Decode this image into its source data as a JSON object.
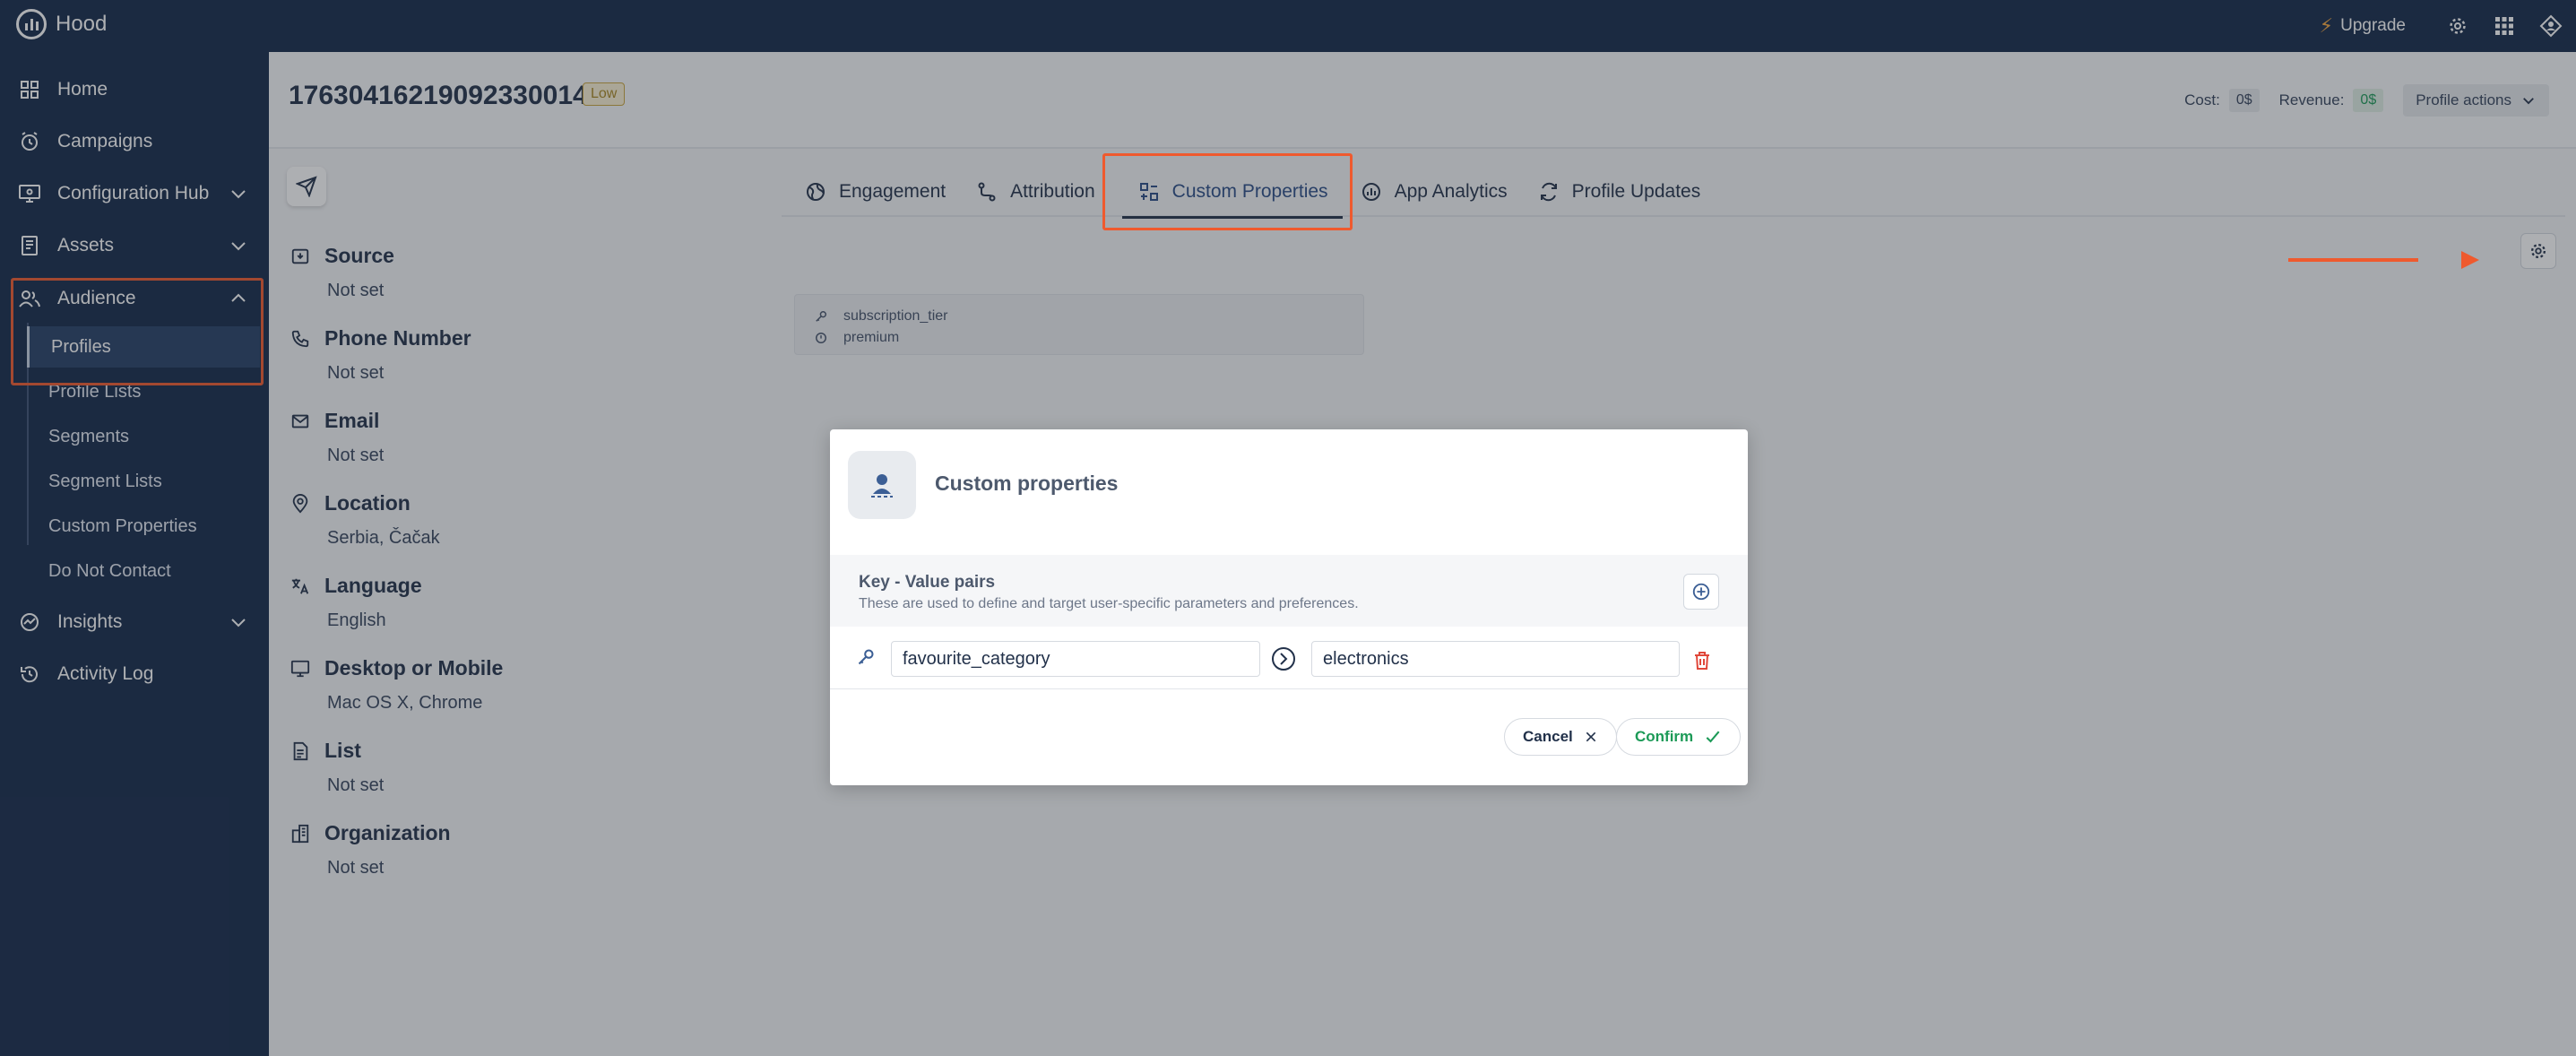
{
  "app": {
    "name": "Hood",
    "upgrade": "Upgrade"
  },
  "colors": {
    "nav_bg": "#14294a",
    "highlight": "#ef5a2e",
    "accent_green": "#1c9a57",
    "badge": "#caa53f"
  },
  "icons": {
    "settings": "gear-icon",
    "apps": "grid-icon",
    "avatar": "diamond-avatar-icon"
  },
  "sidebar": {
    "items": [
      {
        "label": "Home",
        "icon": "home-grid-icon"
      },
      {
        "label": "Campaigns",
        "icon": "clock-icon"
      },
      {
        "label": "Configuration Hub",
        "icon": "monitor-icon"
      },
      {
        "label": "Assets",
        "icon": "document-icon"
      },
      {
        "label": "Audience",
        "icon": "users-icon"
      },
      {
        "label": "Insights",
        "icon": "chart-icon"
      },
      {
        "label": "Activity Log",
        "icon": "history-icon"
      }
    ],
    "audience_sub": [
      "Profiles",
      "Profile Lists",
      "Segments",
      "Segment Lists",
      "Custom Properties",
      "Do Not Contact"
    ],
    "active_sub": "Profiles"
  },
  "profile": {
    "id": "17630416219092330014",
    "badge": "Low",
    "cost_label": "Cost:",
    "cost_value": "0$",
    "revenue_label": "Revenue:",
    "revenue_value": "0$",
    "actions_label": "Profile actions"
  },
  "fields": [
    {
      "label": "Source",
      "value": "Not set",
      "icon": "inbox-icon"
    },
    {
      "label": "Phone Number",
      "value": "Not set",
      "icon": "phone-icon"
    },
    {
      "label": "Email",
      "value": "Not set",
      "icon": "mail-icon"
    },
    {
      "label": "Location",
      "value": "Serbia, Čačak",
      "icon": "pin-icon"
    },
    {
      "label": "Language",
      "value": "English",
      "icon": "language-icon"
    },
    {
      "label": "Desktop or Mobile",
      "value": "Mac OS X, Chrome",
      "icon": "desktop-icon"
    },
    {
      "label": "List",
      "value": "Not set",
      "icon": "list-icon"
    },
    {
      "label": "Organization",
      "value": "Not set",
      "icon": "building-icon"
    }
  ],
  "tabs": [
    {
      "label": "Engagement",
      "icon": "globe-icon"
    },
    {
      "label": "Attribution",
      "icon": "route-icon"
    },
    {
      "label": "Custom Properties",
      "icon": "properties-icon"
    },
    {
      "label": "App Analytics",
      "icon": "analytics-icon"
    },
    {
      "label": "Profile Updates",
      "icon": "refresh-icon"
    }
  ],
  "active_tab": "Custom Properties",
  "existing_property": {
    "key": "subscription_tier",
    "value": "premium"
  },
  "modal": {
    "title": "Custom properties",
    "section_title": "Key - Value pairs",
    "section_desc": "These are used to define and target user-specific parameters and preferences.",
    "pairs": [
      {
        "key": "favourite_category",
        "value": "electronics"
      }
    ],
    "cancel": "Cancel",
    "confirm": "Confirm"
  }
}
